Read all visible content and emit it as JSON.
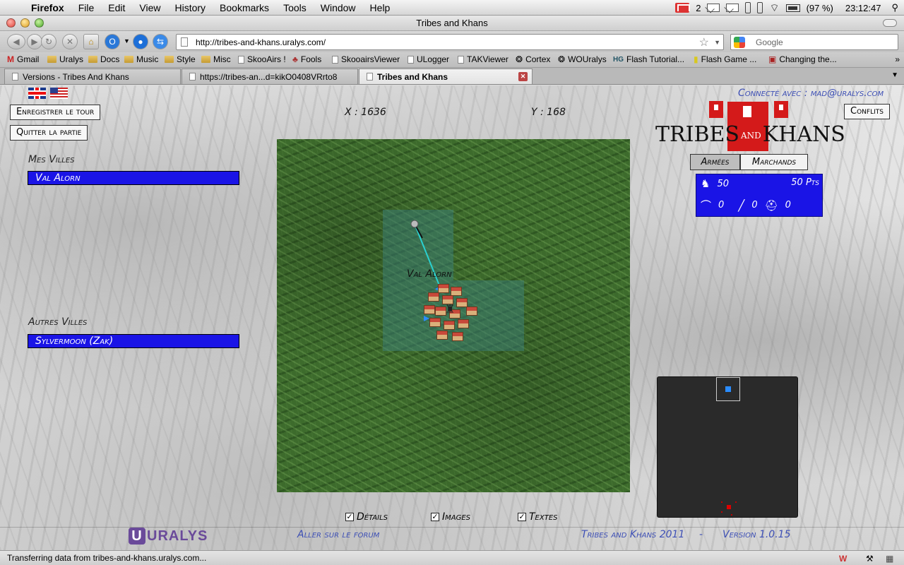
{
  "menubar": {
    "app": "Firefox",
    "items": [
      "File",
      "Edit",
      "View",
      "History",
      "Bookmarks",
      "Tools",
      "Window",
      "Help"
    ],
    "mail_count": "2",
    "battery": "(97 %)",
    "clock": "23:12:47"
  },
  "window": {
    "title": "Tribes and Khans"
  },
  "nav": {
    "url": "http://tribes-and-khans.uralys.com/",
    "search_placeholder": "Google"
  },
  "bookmarks": [
    "Gmail",
    "Uralys",
    "Docs",
    "Music",
    "Style",
    "Misc",
    "SkooAirs !",
    "Fools",
    "SkooairsViewer",
    "ULogger",
    "TAKViewer",
    "Cortex",
    "WOUralys",
    "Flash Tutorial...",
    "Flash Game ...",
    "Changing the..."
  ],
  "tabs": [
    {
      "label": "Versions - Tribes And Khans"
    },
    {
      "label": "https://tribes-an...d=kikO0408VRrto8"
    },
    {
      "label": "Tribes and Khans"
    }
  ],
  "game": {
    "connected": "Connecté avec : mad@uralys.com",
    "save_turn": "Enregistrer le tour",
    "quit_game": "Quitter la partie",
    "conflicts": "Conflits",
    "coord_x": "X : 1636",
    "coord_y": "Y : 168",
    "my_cities_label": "Mes Villes",
    "my_cities": [
      "Val Alorn"
    ],
    "other_cities_label": "Autres Villes",
    "other_cities": [
      "Sylvermoon (Zak)"
    ],
    "map_city_label": "Val Alorn",
    "brand_left": "TRIBES",
    "brand_and": "AND",
    "brand_right": "KHANS",
    "tab_armies": "Armées",
    "tab_merchants": "Marchands",
    "army": {
      "soldiers": "50",
      "points": "50 Pts",
      "bows": "0",
      "spears": "0",
      "helmets": "0"
    },
    "options": [
      {
        "label": "Détails",
        "checked": true
      },
      {
        "label": "Images",
        "checked": true
      },
      {
        "label": "Textes",
        "checked": true
      }
    ],
    "footer_logo": "URALYS",
    "forum_link": "Aller sur le forum",
    "footer_title": "Tribes and Khans 2011",
    "footer_sep": "-",
    "footer_version": "Version 1.0.15"
  },
  "status": {
    "message": "Transferring data from tribes-and-khans.uralys.com..."
  },
  "colors": {
    "city_bar": "#1a14e6",
    "brand_red": "#d41a1a",
    "link_blue": "#3d4fb5"
  }
}
